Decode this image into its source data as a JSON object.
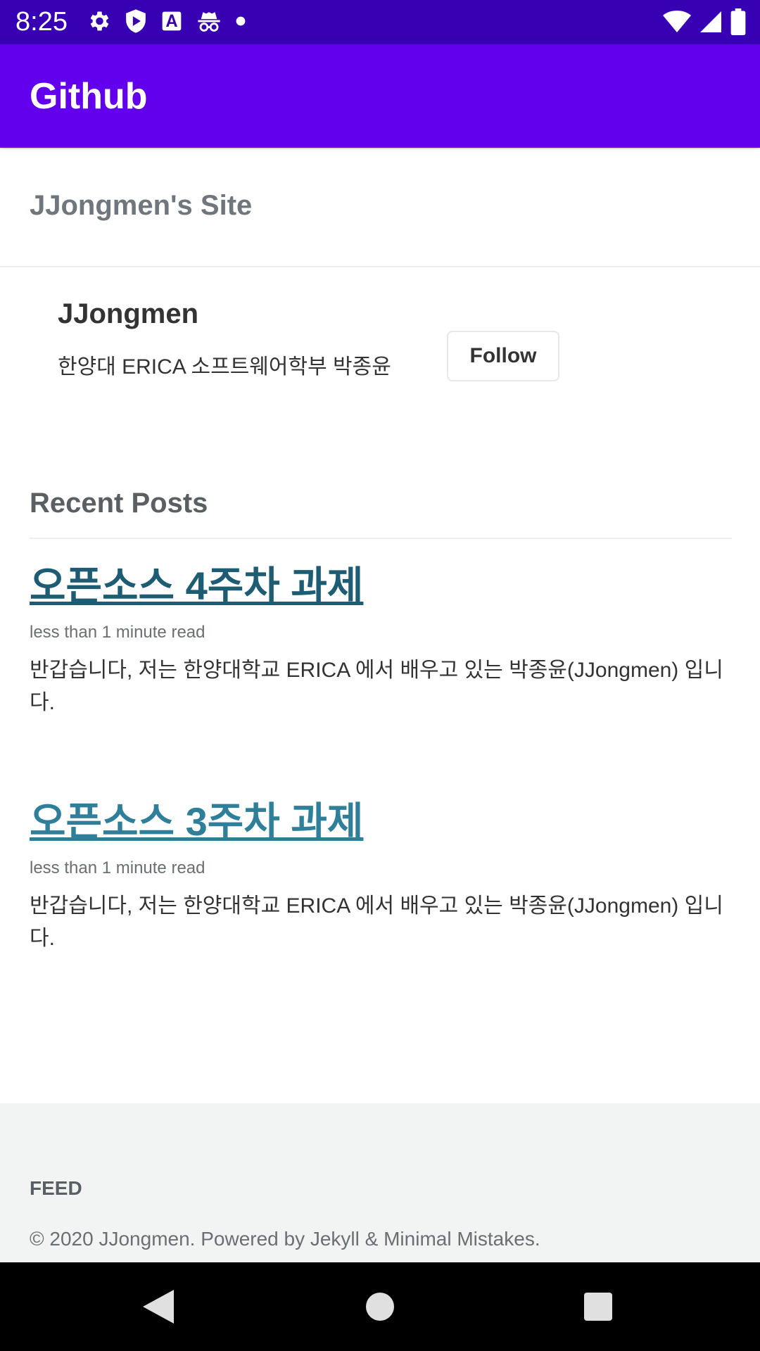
{
  "status_bar": {
    "time": "8:25",
    "left_icons": [
      "gear-icon",
      "shield-play-icon",
      "text-a-icon",
      "incognito-icon",
      "dot-icon"
    ],
    "right_icons": [
      "wifi-icon",
      "cell-signal-icon",
      "battery-icon"
    ]
  },
  "app_bar": {
    "title": "Github"
  },
  "site": {
    "title": "JJongmen's Site"
  },
  "author": {
    "name": "JJongmen",
    "bio": "한양대 ERICA 소프트웨어학부 박종윤",
    "follow_label": "Follow"
  },
  "recent": {
    "heading": "Recent Posts",
    "posts": [
      {
        "title": "오픈소스 4주차 과제",
        "meta": "less than 1 minute read",
        "excerpt": "반갑습니다, 저는 한양대학교 ERICA 에서 배우고 있는 박종윤(JJongmen) 입니다."
      },
      {
        "title": "오픈소스 3주차 과제",
        "meta": "less than 1 minute read",
        "excerpt": "반갑습니다, 저는 한양대학교 ERICA 에서 배우고 있는 박종윤(JJongmen) 입니다."
      }
    ]
  },
  "footer": {
    "feed": "FEED",
    "copyright": "© 2020 JJongmen. Powered by Jekyll & Minimal Mistakes."
  },
  "nav": {
    "buttons": [
      "back-icon",
      "home-icon",
      "recents-icon"
    ]
  },
  "colors": {
    "status_bar": "#3700b3",
    "app_bar": "#6200ee",
    "link_visited": "#1d5c72",
    "link": "#2f7f9a",
    "footer_bg": "#f2f3f3"
  }
}
